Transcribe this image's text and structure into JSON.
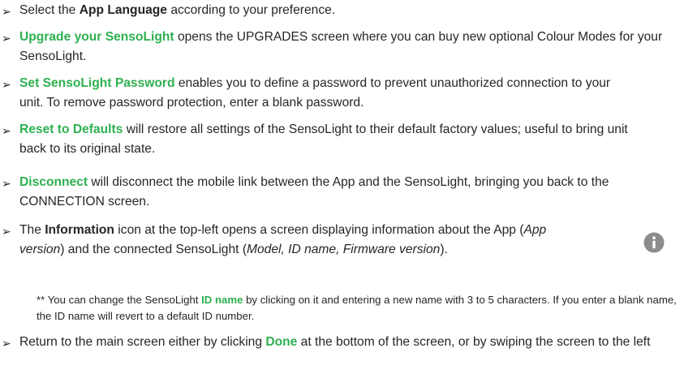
{
  "items": [
    {
      "pre": "Select the ",
      "hl": "App Language",
      "post": " according to your preference."
    },
    {
      "hl": "Upgrade your SensoLight",
      "post": " opens the UPGRADES screen where you can buy new optional Colour Modes for your SensoLight."
    },
    {
      "hl": "Set SensoLight Password",
      "post": " enables you to define a password to prevent unauthorized connection to your unit. To remove password protection, enter a blank password."
    },
    {
      "hl": "Reset to Defaults",
      "post": " will restore all settings of the SensoLight to their default factory values; useful to bring unit back to its original state."
    },
    {
      "hl": "Disconnect",
      "post": " will disconnect the mobile link between the App and the SensoLight, bringing you back to the CONNECTION screen."
    },
    {
      "pre": "The ",
      "hl": "Information",
      "mid": " icon at the top-left opens a screen displaying information about the App (",
      "it1": "App version",
      "mid2": ") and the connected SensoLight (",
      "it2": "Model, ID name, Firmware version",
      "post": ")."
    },
    {
      "pre": "Return to the main screen either by clicking ",
      "hl": "Done",
      "post": " at the bottom of the screen, or by swiping the screen to the left"
    }
  ],
  "note": {
    "pre": "** You can change the SensoLight ",
    "hl": "ID name",
    "post": " by clicking on it and entering a new name with 3 to 5 characters. If you enter a blank name, the ID name will revert to a default ID number."
  },
  "bullet_glyph": "➢",
  "info_icon": "info-circle-icon",
  "colors": {
    "highlight": "#2eb050",
    "text": "#262626",
    "icon": "#8c8c8c"
  }
}
